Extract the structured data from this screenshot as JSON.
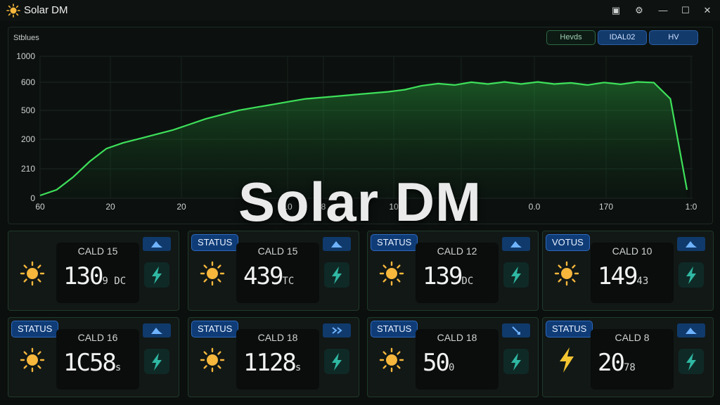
{
  "window": {
    "title": "Solar DM",
    "app_icon": "sun-icon",
    "controls": [
      "folder-icon",
      "settings-icon",
      "minimize-icon",
      "maximize-icon",
      "close-icon"
    ]
  },
  "chart_panel": {
    "label": "Stblues",
    "toggles": [
      "Hevds",
      "IDAL02",
      "HV"
    ],
    "overlay_title": "Solar DM"
  },
  "chart_data": {
    "type": "area",
    "ylim": [
      0,
      1000
    ],
    "y_ticks": [
      "0",
      "210",
      "200",
      "500",
      "600",
      "1000"
    ],
    "x_ticks": [
      "60",
      "20",
      "20",
      "10",
      "8",
      "10",
      "0",
      "0.0",
      "170",
      "1:0"
    ],
    "color": "#39d353",
    "series": [
      {
        "values": [
          20,
          60,
          150,
          260,
          350,
          390,
          420,
          450,
          480,
          520,
          560,
          590,
          620,
          640,
          660,
          680,
          700,
          710,
          720,
          730,
          740,
          750,
          765,
          800,
          800,
          805,
          810,
          812,
          812,
          812,
          812,
          812,
          805,
          805,
          808,
          810,
          812,
          815,
          700,
          60
        ]
      }
    ]
  },
  "cards": [
    {
      "status": "",
      "cald": "CALD 15",
      "value": "130",
      "suffix": "9 DC",
      "icon": "sun-icon",
      "trend": "up"
    },
    {
      "status": "STATUS",
      "cald": "CALD 15",
      "value": "439",
      "suffix": "TC",
      "icon": "sun-icon",
      "trend": "up"
    },
    {
      "status": "STATUS",
      "cald": "CALD 12",
      "value": "139",
      "suffix": "DC",
      "icon": "sun-icon",
      "trend": "up"
    },
    {
      "status": "VOTUS",
      "cald": "CALD 10",
      "value": "149",
      "suffix": "43",
      "icon": "sun-icon",
      "trend": "up"
    },
    {
      "status": "STATUS",
      "cald": "CALD 16",
      "value": "1C58",
      "suffix": "s",
      "icon": "sun-icon",
      "trend": "up"
    },
    {
      "status": "STATUS",
      "cald": "CALD 18",
      "value": "1128",
      "suffix": "s",
      "icon": "sun-icon",
      "trend": "forward"
    },
    {
      "status": "STATUS",
      "cald": "CALD 18",
      "value": "50",
      "suffix": "0",
      "icon": "sun-icon",
      "trend": "down"
    },
    {
      "status": "STATUS",
      "cald": "CALD 8",
      "value": "20",
      "suffix": "78",
      "icon": "bolt-icon",
      "trend": "up"
    }
  ]
}
